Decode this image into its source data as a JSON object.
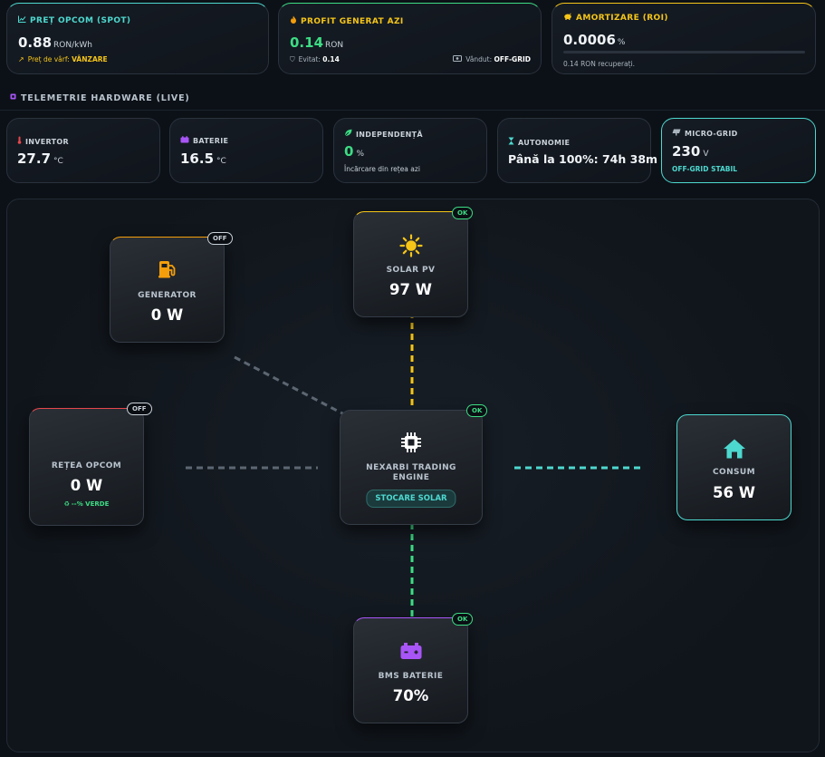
{
  "top_cards": {
    "price": {
      "label": "PREȚ OPCOM (SPOT)",
      "value": "0.88",
      "unit": "RON/kWh",
      "sub_prefix": "Preț de vârf:",
      "sub_value": "VÂNZARE",
      "icon": "chart-line-icon"
    },
    "profit": {
      "label": "PROFIT GENERAT AZI",
      "value": "0.14",
      "unit": "RON",
      "avoided_label": "Evitat:",
      "avoided_value": "0.14",
      "sold_label": "Vândut:",
      "sold_value": "OFF-GRID",
      "icon": "fire-icon"
    },
    "roi": {
      "label": "AMORTIZARE (ROI)",
      "value": "0.0006",
      "unit": "%",
      "sub": "0.14 RON recuperați.",
      "progress": 0.0006,
      "icon": "piggy-bank-icon"
    }
  },
  "telemetry": {
    "title": "TELEMETRIE HARDWARE (LIVE)",
    "inverter": {
      "label": "INVERTOR",
      "value": "27.7",
      "unit": "°C"
    },
    "battery": {
      "label": "BATERIE",
      "value": "16.5",
      "unit": "°C"
    },
    "independence": {
      "label": "INDEPENDENȚĂ",
      "value": "0",
      "unit": "%",
      "sub": "Încărcare din rețea azi"
    },
    "autonomy": {
      "label": "AUTONOMIE",
      "value": "Până la 100%: 74h 38m"
    },
    "microgrid": {
      "label": "MICRO-GRID",
      "value": "230",
      "unit": "V",
      "sub": "OFF-GRID STABIL"
    }
  },
  "flow": {
    "solar": {
      "label": "SOLAR PV",
      "value": "97 W",
      "badge": "OK"
    },
    "generator": {
      "label": "GENERATOR",
      "value": "0 W",
      "badge": "OFF"
    },
    "grid": {
      "label": "REȚEA OPCOM",
      "value": "0 W",
      "badge": "OFF",
      "sub": "--% VERDE"
    },
    "engine": {
      "label": "NEXARBI TRADING ENGINE",
      "mode": "STOCARE SOLAR",
      "badge": "OK"
    },
    "consumption": {
      "label": "CONSUM",
      "value": "56 W"
    },
    "bms": {
      "label": "BMS BATERIE",
      "value": "70%",
      "badge": "OK"
    }
  },
  "colors": {
    "accent_teal": "#4dd8cf",
    "ok_green": "#3ddc84",
    "solar_yellow": "#f5c518",
    "generator_orange": "#f59e0b",
    "grid_red": "#e5484d",
    "battery_purple": "#a855f7"
  }
}
